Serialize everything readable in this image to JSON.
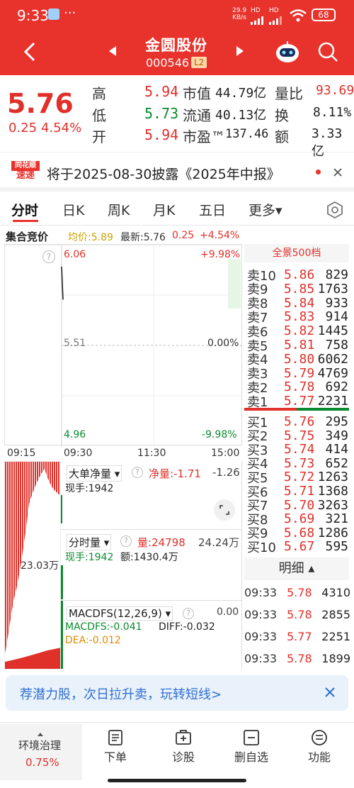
{
  "status_bar": {
    "time": "9:33",
    "dots": "···",
    "net_speed_top": "29.9",
    "net_speed_bottom": "KB/s",
    "hd1": "HD",
    "hd2": "HD",
    "battery": "68"
  },
  "header": {
    "title": "金圆股份",
    "code": "000546",
    "level": "L2"
  },
  "quote": {
    "price": "5.76",
    "change": "0.25",
    "change_pct": "4.54%",
    "items": [
      {
        "label": "高",
        "value": "5.94"
      },
      {
        "label": "低",
        "value": "5.73"
      },
      {
        "label": "开",
        "value": "5.94"
      }
    ],
    "stats": [
      {
        "label": "市值",
        "value": "44.79亿"
      },
      {
        "label": "流通",
        "value": "40.13亿"
      },
      {
        "label": "市盈™",
        "value": "137.46"
      }
    ],
    "stats2": [
      {
        "label": "量比",
        "value": "93.69"
      },
      {
        "label": "换",
        "value": "8.11%"
      },
      {
        "label": "额",
        "value": "3.33亿"
      }
    ]
  },
  "announcement": {
    "logo_top": "同花顺",
    "logo_bottom": "速递",
    "text": "将于2025-08-30披露《2025年中报》"
  },
  "tabs": {
    "items": [
      "分时",
      "日K",
      "周K",
      "月K",
      "五日"
    ],
    "more": "更多▾"
  },
  "chart": {
    "mode": "集合竞价",
    "avg_label": "均价:5.89",
    "latest_label": "最新:5.76",
    "latest_change": "0.25",
    "latest_pct": "+4.54%",
    "price_top": "6.06",
    "price_mid": "5.51",
    "price_bottom": "4.96",
    "pct_top": "+9.98%",
    "pct_mid": "0.00%",
    "pct_bottom": "-9.98%",
    "times": [
      "09:15",
      "09:30",
      "11:30",
      "15:00"
    ]
  },
  "chart_data": {
    "type": "line",
    "title": "",
    "y_range": [
      4.96,
      6.06
    ],
    "series": [
      {
        "name": "price",
        "points": [
          5.94,
          5.76
        ]
      }
    ]
  },
  "panels": {
    "bigorder": {
      "label": "大单净量",
      "net_label": "净量:",
      "net_value": "-1.71",
      "right_value": "-1.26",
      "hand": "现手:1942"
    },
    "volume": {
      "label": "分时量",
      "vol_label": "量:",
      "vol_value": "24798",
      "right_value": "24.24万",
      "hand": "现手:1942",
      "amount": "额:1430.4万"
    },
    "macd": {
      "label": "MACDFS(12,26,9)",
      "right_value": "0.00",
      "macd_value": "MACDFS:-0.041",
      "diff": "DIFF:-0.032",
      "dea": "DEA:-0.012"
    },
    "left_vol_label": "23.03万"
  },
  "orderbook": {
    "header": "全景500档",
    "asks": [
      {
        "label": "卖10",
        "price": "5.86",
        "vol": "829"
      },
      {
        "label": "卖9",
        "price": "5.85",
        "vol": "1763"
      },
      {
        "label": "卖8",
        "price": "5.84",
        "vol": "933"
      },
      {
        "label": "卖7",
        "price": "5.83",
        "vol": "914"
      },
      {
        "label": "卖6",
        "price": "5.82",
        "vol": "1445"
      },
      {
        "label": "卖5",
        "price": "5.81",
        "vol": "758"
      },
      {
        "label": "卖4",
        "price": "5.80",
        "vol": "6062"
      },
      {
        "label": "卖3",
        "price": "5.79",
        "vol": "4769"
      },
      {
        "label": "卖2",
        "price": "5.78",
        "vol": "692"
      },
      {
        "label": "卖1",
        "price": "5.77",
        "vol": "2231"
      }
    ],
    "bids": [
      {
        "label": "买1",
        "price": "5.76",
        "vol": "295"
      },
      {
        "label": "买2",
        "price": "5.75",
        "vol": "349"
      },
      {
        "label": "买3",
        "price": "5.74",
        "vol": "414"
      },
      {
        "label": "买4",
        "price": "5.73",
        "vol": "652"
      },
      {
        "label": "买5",
        "price": "5.72",
        "vol": "1263"
      },
      {
        "label": "买6",
        "price": "5.71",
        "vol": "1368"
      },
      {
        "label": "买7",
        "price": "5.70",
        "vol": "3263"
      },
      {
        "label": "买8",
        "price": "5.69",
        "vol": "321"
      },
      {
        "label": "买9",
        "price": "5.68",
        "vol": "1286"
      },
      {
        "label": "买10",
        "price": "5.67",
        "vol": "595"
      }
    ]
  },
  "trades": {
    "header": "明细 ▴",
    "rows": [
      {
        "time": "09:33",
        "price": "5.78",
        "vol": "4310"
      },
      {
        "time": "09:33",
        "price": "5.78",
        "vol": "2855"
      },
      {
        "time": "09:33",
        "price": "5.77",
        "vol": "2251"
      },
      {
        "time": "09:33",
        "price": "5.78",
        "vol": "1899"
      }
    ]
  },
  "promo": {
    "text": "荐潜力股，次日拉升卖，玩转短线>"
  },
  "bottom_nav": {
    "first_label": "环境治理",
    "first_value": "0.75%",
    "items": [
      {
        "label": "下单"
      },
      {
        "label": "诊股"
      },
      {
        "label": "删自选"
      },
      {
        "label": "功能"
      }
    ]
  },
  "colors": {
    "brand": "#e8322c",
    "up": "#e0302a",
    "down": "#0a8a2e",
    "avg_line": "#c9a400"
  }
}
